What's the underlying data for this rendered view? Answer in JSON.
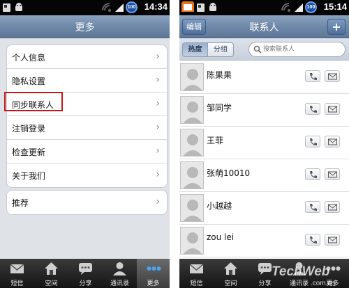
{
  "left": {
    "status": {
      "time": "14:34",
      "battery": "100"
    },
    "title": "更多",
    "groups": [
      [
        "个人信息",
        "隐私设置",
        "同步联系人",
        "注销登录",
        "检查更新",
        "关于我们"
      ],
      [
        "推荐"
      ]
    ],
    "tabs": [
      "短信",
      "空间",
      "分享",
      "通讯录",
      "更多"
    ]
  },
  "right": {
    "status": {
      "time": "15:14",
      "battery": "100"
    },
    "title": "联系人",
    "edit_label": "编辑",
    "add_label": "+",
    "segments": [
      "热度",
      "分组"
    ],
    "search_placeholder": "搜索联系人",
    "contacts": [
      "陈果果",
      "邹同学",
      "王菲",
      "张萌10010",
      "小越越",
      "zou lei"
    ],
    "tabs": [
      "短信",
      "空间",
      "分享",
      "通讯录",
      "更多"
    ],
    "watermark": "TechWeb.com.cn"
  },
  "colors": {
    "highlight": "#c01818",
    "titlebar": "#6d86a6",
    "tabbar": "#141414"
  }
}
